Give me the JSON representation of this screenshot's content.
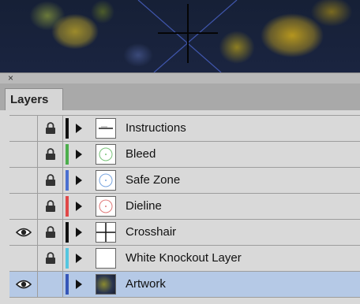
{
  "panel": {
    "close_glyph": "×",
    "tab_label": "Layers"
  },
  "colors": {
    "selected_row": "#b5c9e6",
    "panel_bg": "#d9d9d9"
  },
  "layers": [
    {
      "name": "Instructions",
      "visible": false,
      "locked": true,
      "color": "#111111",
      "thumb": "instructions"
    },
    {
      "name": "Bleed",
      "visible": false,
      "locked": true,
      "color": "#4cae4c",
      "thumb": "circle-green"
    },
    {
      "name": "Safe Zone",
      "visible": false,
      "locked": true,
      "color": "#4a6fd0",
      "thumb": "circle-blue"
    },
    {
      "name": "Dieline",
      "visible": false,
      "locked": true,
      "color": "#e04848",
      "thumb": "circle-red"
    },
    {
      "name": "Crosshair",
      "visible": true,
      "locked": true,
      "color": "#111111",
      "thumb": "crosshair"
    },
    {
      "name": "White Knockout Layer",
      "visible": false,
      "locked": true,
      "color": "#55c6e0",
      "thumb": "blank"
    },
    {
      "name": "Artwork",
      "visible": true,
      "locked": false,
      "color": "#3556b8",
      "thumb": "artwork",
      "selected": true
    }
  ]
}
